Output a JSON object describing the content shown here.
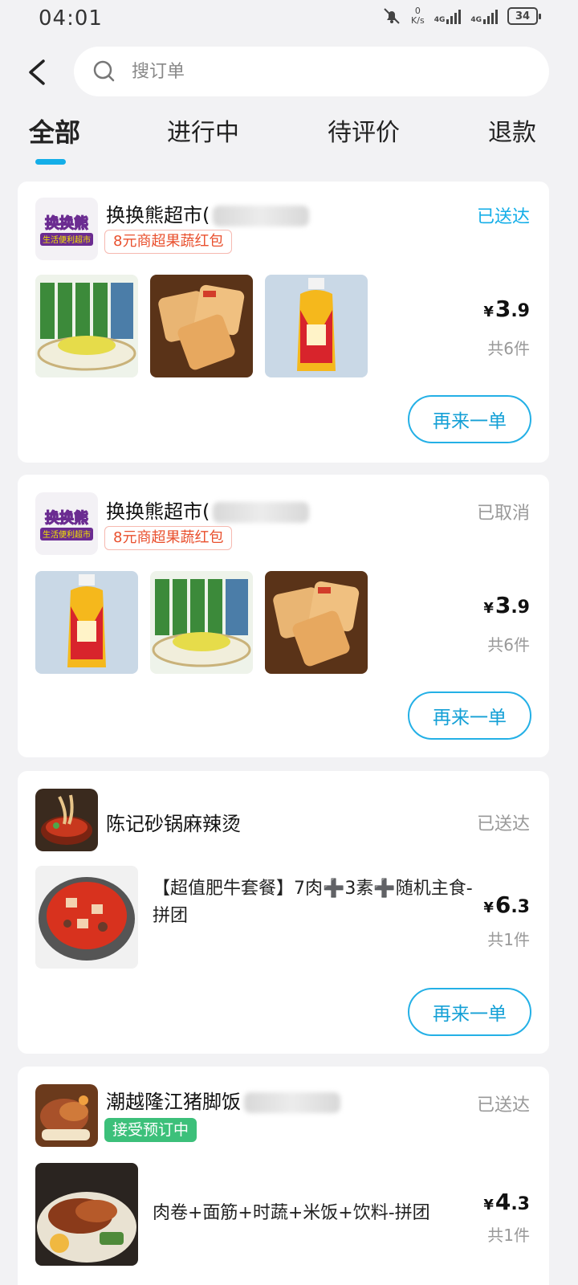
{
  "status_bar": {
    "time": "04:01",
    "net_speed": "0",
    "net_unit": "K/s",
    "sig1_label": "4G",
    "sig2_label": "4G",
    "battery": "34"
  },
  "search": {
    "placeholder": "搜订单"
  },
  "tabs": [
    {
      "label": "全部",
      "active": true
    },
    {
      "label": "进行中"
    },
    {
      "label": "待评价"
    },
    {
      "label": "退款"
    }
  ],
  "colors": {
    "accent": "#14aee8",
    "promo": "#e9502e",
    "green_tag": "#3cc07a"
  },
  "orders": [
    {
      "store": "换换熊超市(",
      "logo": "换换熊",
      "logo_sub": "生活便利超市",
      "status": "已送达",
      "tag": "8元商超果蔬红包",
      "price_int": "3",
      "price_dec": ".9",
      "currency": "¥",
      "qty": "共6件",
      "reorder": "再来一单",
      "thumbs": [
        "bamboo-shoot-pack",
        "bread-pack",
        "tea-bottle"
      ]
    },
    {
      "store": "换换熊超市(",
      "logo": "换换熊",
      "logo_sub": "生活便利超市",
      "status": "已取消",
      "tag": "8元商超果蔬红包",
      "price_int": "3",
      "price_dec": ".9",
      "currency": "¥",
      "qty": "共6件",
      "reorder": "再来一单",
      "thumbs": [
        "tea-bottle",
        "bamboo-shoot-pack",
        "bread-pack"
      ]
    },
    {
      "store": "陈记砂锅麻辣烫",
      "status": "已送达",
      "item": "【超值肥牛套餐】7肉➕3素➕随机主食-拼团",
      "price_int": "6",
      "price_dec": ".3",
      "currency": "¥",
      "qty": "共1件",
      "reorder": "再来一单"
    },
    {
      "store": "潮越隆江猪脚饭",
      "status": "已送达",
      "tag": "接受预订中",
      "item": "肉卷+面筋+时蔬+米饭+饮料-拼团",
      "price_int": "4",
      "price_dec": ".3",
      "currency": "¥",
      "qty": "共1件"
    }
  ]
}
